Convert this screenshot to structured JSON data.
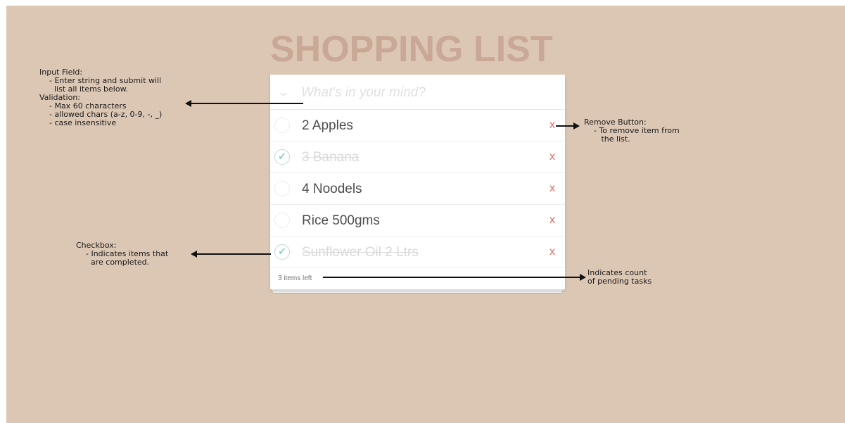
{
  "app": {
    "title": "SHOPPING LIST",
    "input": {
      "placeholder": "What's in your mind?",
      "value": ""
    },
    "toggle_all_icon": "chevron-down-icon",
    "items": [
      {
        "text": "2 Apples",
        "completed": false,
        "remove_label": "x"
      },
      {
        "text": "3 Banana",
        "completed": true,
        "remove_label": "x"
      },
      {
        "text": "4 Noodels",
        "completed": false,
        "remove_label": "x"
      },
      {
        "text": "Rice 500gms",
        "completed": false,
        "remove_label": "x"
      },
      {
        "text": "Sunflower Oil 2 Ltrs",
        "completed": true,
        "remove_label": "x"
      }
    ],
    "checkmark": "✓",
    "footer": {
      "count_text": "3 items left"
    }
  },
  "annotations": {
    "input_field": "Input Field:\n    - Enter string and submit will\n      list all items below.\nValidation:\n    - Max 60 characters\n    - allowed chars (a-z, 0-9, -, _)\n    - case insensitive",
    "checkbox": "Checkbox:\n    - Indicates items that\n      are completed.",
    "remove_button": "Remove Button:\n    - To remove item from\n       the list.",
    "count": "Indicates count\nof pending tasks"
  },
  "colors": {
    "background": "#dcc7b4",
    "title": "#c9a895",
    "check": "#5dc2af",
    "remove": "#e8675f"
  }
}
